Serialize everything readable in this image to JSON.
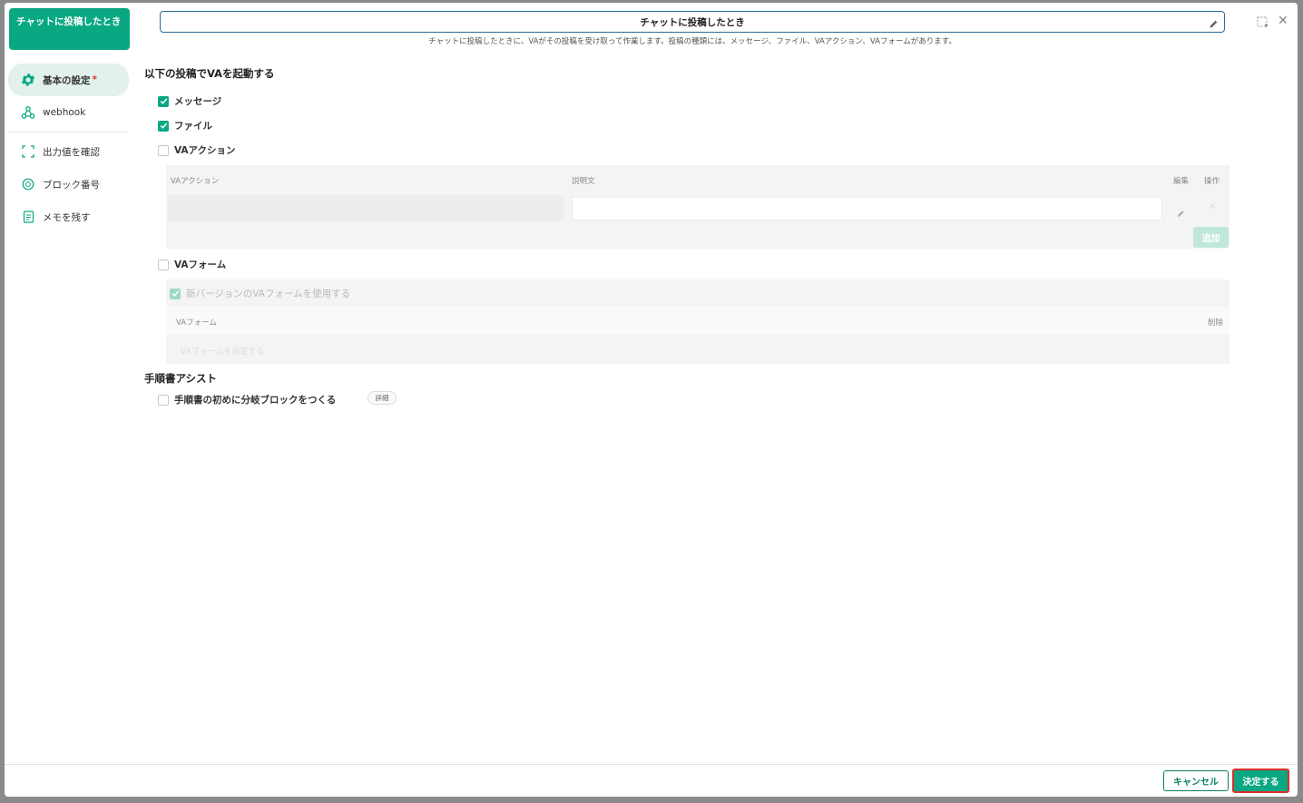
{
  "block": {
    "title": "チャットに投稿したとき"
  },
  "nav": {
    "items": [
      {
        "label": "基本の設定",
        "required_mark": "*",
        "icon": "gear-icon"
      },
      {
        "label": "webhook",
        "icon": "webhook-icon"
      },
      {
        "label": "出力値を確認",
        "icon": "bracket-icon"
      },
      {
        "label": "ブロック番号",
        "icon": "number-circle-icon"
      },
      {
        "label": "メモを残す",
        "icon": "memo-icon"
      }
    ]
  },
  "header": {
    "name_value": "チャットに投稿したとき",
    "description": "チャットに投稿したときに、VAがその投稿を受け取って作業します。投稿の種類には、メッセージ、ファイル、VAアクション、VAフォームがあります。"
  },
  "trigger": {
    "heading": "以下の投稿でVAを起動する",
    "message_label": "メッセージ",
    "message_checked": true,
    "file_label": "ファイル",
    "file_checked": true,
    "va_action_label": "VAアクション",
    "va_action_checked": false,
    "va_action_table": {
      "col_action": "VAアクション",
      "col_desc": "説明文",
      "col_edit": "編集",
      "col_op": "操作",
      "add_label": "追加"
    },
    "va_form_label": "VAフォーム",
    "va_form_checked": false,
    "new_version_label": "新バージョンのVAフォームを使用する",
    "new_version_checked": true,
    "va_form_table": {
      "col_form": "VAフォーム",
      "col_delete": "削除",
      "placeholder": "VAフォームを設定する"
    }
  },
  "assist": {
    "heading": "手順書アシスト",
    "branch_label": "手順書の初めに分岐ブロックをつくる",
    "branch_checked": false,
    "detail_label": "詳細"
  },
  "footer": {
    "cancel_label": "キャンセル",
    "confirm_label": "決定する"
  },
  "colors": {
    "accent": "#0aa882",
    "input_border": "#2b6d96",
    "highlight_border": "#e02d2d"
  }
}
